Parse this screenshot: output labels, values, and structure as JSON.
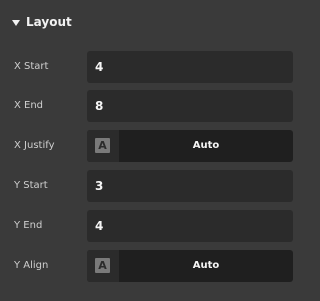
{
  "section": {
    "title": "Layout"
  },
  "fields": {
    "x_start": {
      "label": "X Start",
      "value": "4"
    },
    "x_end": {
      "label": "X End",
      "value": "8"
    },
    "x_justify": {
      "label": "X Justify",
      "value": "Auto",
      "icon": "A"
    },
    "y_start": {
      "label": "Y Start",
      "value": "3"
    },
    "y_end": {
      "label": "Y End",
      "value": "4"
    },
    "y_align": {
      "label": "Y Align",
      "value": "Auto",
      "icon": "A"
    }
  }
}
